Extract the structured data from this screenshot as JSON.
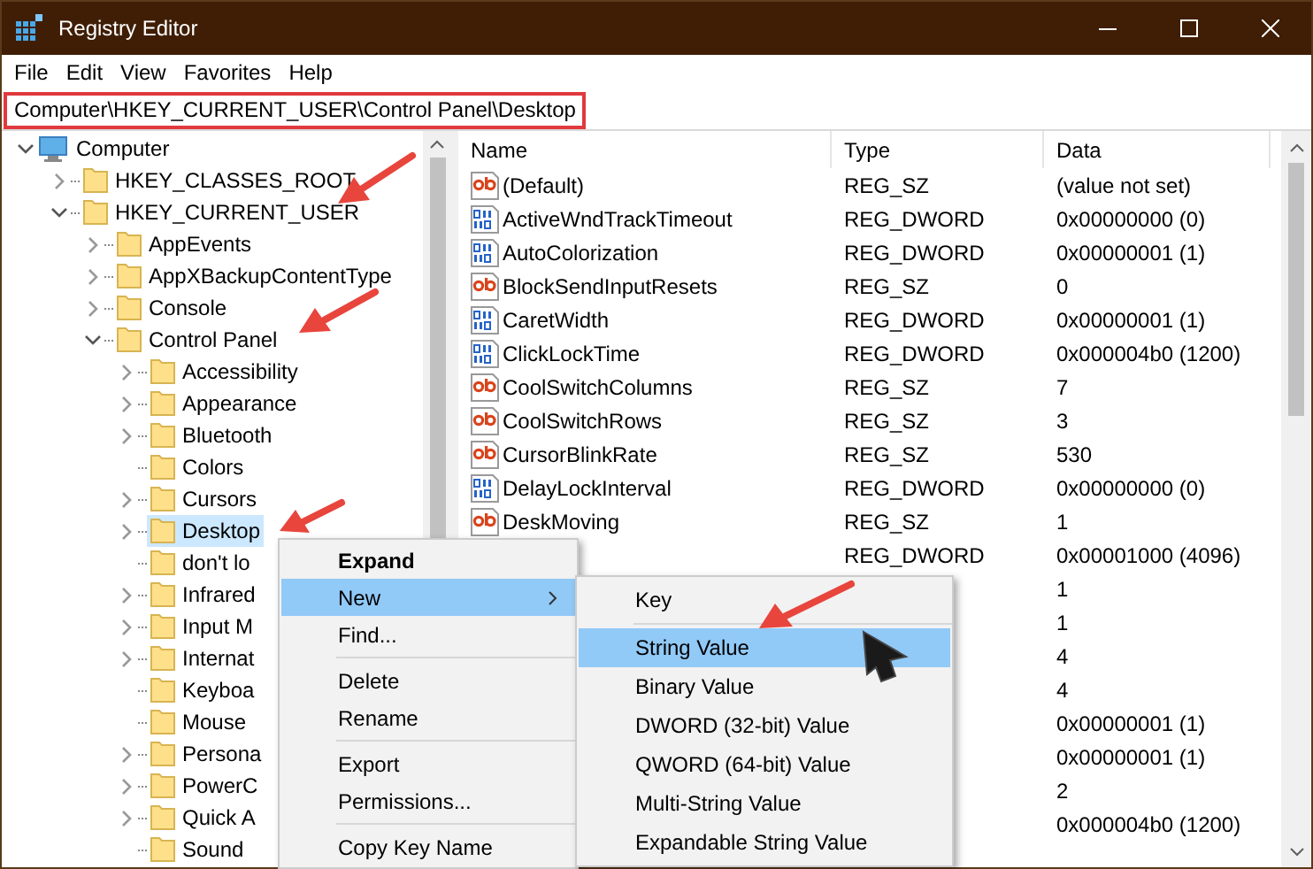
{
  "window": {
    "title": "Registry Editor"
  },
  "menu_bar": [
    "File",
    "Edit",
    "View",
    "Favorites",
    "Help"
  ],
  "address_bar": {
    "value": "Computer\\HKEY_CURRENT_USER\\Control Panel\\Desktop"
  },
  "tree": [
    {
      "label": "Computer",
      "kind": "computer",
      "expandable": true,
      "expanded": true,
      "selected": false,
      "children": [
        {
          "label": "HKEY_CLASSES_ROOT",
          "kind": "folder",
          "expandable": true,
          "expanded": false,
          "selected": false
        },
        {
          "label": "HKEY_CURRENT_USER",
          "kind": "folder",
          "expandable": true,
          "expanded": true,
          "selected": false,
          "children": [
            {
              "label": "AppEvents",
              "kind": "folder",
              "expandable": true,
              "expanded": false,
              "selected": false
            },
            {
              "label": "AppXBackupContentType",
              "kind": "folder",
              "expandable": true,
              "expanded": false,
              "selected": false
            },
            {
              "label": "Console",
              "kind": "folder",
              "expandable": true,
              "expanded": false,
              "selected": false
            },
            {
              "label": "Control Panel",
              "kind": "folder",
              "expandable": true,
              "expanded": true,
              "selected": false,
              "children": [
                {
                  "label": "Accessibility",
                  "kind": "folder",
                  "expandable": true,
                  "expanded": false,
                  "selected": false
                },
                {
                  "label": "Appearance",
                  "kind": "folder",
                  "expandable": true,
                  "expanded": false,
                  "selected": false
                },
                {
                  "label": "Bluetooth",
                  "kind": "folder",
                  "expandable": true,
                  "expanded": false,
                  "selected": false
                },
                {
                  "label": "Colors",
                  "kind": "folder",
                  "expandable": false,
                  "selected": false
                },
                {
                  "label": "Cursors",
                  "kind": "folder",
                  "expandable": true,
                  "expanded": false,
                  "selected": false
                },
                {
                  "label": "Desktop",
                  "kind": "folder",
                  "expandable": true,
                  "expanded": false,
                  "selected": true
                },
                {
                  "label": "don't lo",
                  "kind": "folder",
                  "expandable": false,
                  "selected": false
                },
                {
                  "label": "Infrared",
                  "kind": "folder",
                  "expandable": true,
                  "expanded": false,
                  "selected": false
                },
                {
                  "label": "Input M",
                  "kind": "folder",
                  "expandable": true,
                  "expanded": false,
                  "selected": false
                },
                {
                  "label": "Internat",
                  "kind": "folder",
                  "expandable": true,
                  "expanded": false,
                  "selected": false
                },
                {
                  "label": "Keyboa",
                  "kind": "folder",
                  "expandable": false,
                  "selected": false
                },
                {
                  "label": "Mouse",
                  "kind": "folder",
                  "expandable": false,
                  "selected": false
                },
                {
                  "label": "Persona",
                  "kind": "folder",
                  "expandable": true,
                  "expanded": false,
                  "selected": false
                },
                {
                  "label": "PowerC",
                  "kind": "folder",
                  "expandable": true,
                  "expanded": false,
                  "selected": false
                },
                {
                  "label": "Quick A",
                  "kind": "folder",
                  "expandable": true,
                  "expanded": false,
                  "selected": false
                },
                {
                  "label": "Sound",
                  "kind": "folder",
                  "expandable": false,
                  "selected": false
                }
              ]
            }
          ]
        }
      ]
    }
  ],
  "values": {
    "columns": [
      "Name",
      "Type",
      "Data"
    ],
    "rows": [
      {
        "kind": "string",
        "name": "(Default)",
        "type": "REG_SZ",
        "data": "(value not set)"
      },
      {
        "kind": "dword",
        "name": "ActiveWndTrackTimeout",
        "type": "REG_DWORD",
        "data": "0x00000000 (0)"
      },
      {
        "kind": "dword",
        "name": "AutoColorization",
        "type": "REG_DWORD",
        "data": "0x00000001 (1)"
      },
      {
        "kind": "string",
        "name": "BlockSendInputResets",
        "type": "REG_SZ",
        "data": "0"
      },
      {
        "kind": "dword",
        "name": "CaretWidth",
        "type": "REG_DWORD",
        "data": "0x00000001 (1)"
      },
      {
        "kind": "dword",
        "name": "ClickLockTime",
        "type": "REG_DWORD",
        "data": "0x000004b0 (1200)"
      },
      {
        "kind": "string",
        "name": "CoolSwitchColumns",
        "type": "REG_SZ",
        "data": "7"
      },
      {
        "kind": "string",
        "name": "CoolSwitchRows",
        "type": "REG_SZ",
        "data": "3"
      },
      {
        "kind": "string",
        "name": "CursorBlinkRate",
        "type": "REG_SZ",
        "data": "530"
      },
      {
        "kind": "dword",
        "name": "DelayLockInterval",
        "type": "REG_DWORD",
        "data": "0x00000000 (0)"
      },
      {
        "kind": "string",
        "name": "DeskMoving",
        "type": "REG_SZ",
        "data": "1"
      },
      {
        "type": "REG_DWORD",
        "data": "0x00001000 (4096)"
      },
      {
        "data": "1"
      },
      {
        "data": "1"
      },
      {
        "data": "4"
      },
      {
        "data": "4"
      },
      {
        "data": "0x00000001 (1)"
      },
      {
        "data": "0x00000001 (1)"
      },
      {
        "data": "2"
      },
      {
        "data": "0x000004b0 (1200)"
      }
    ]
  },
  "context_menu": [
    {
      "kind": "item",
      "label": "Expand",
      "bold": true,
      "selected": false,
      "submenu": false
    },
    {
      "kind": "item",
      "label": "New",
      "bold": false,
      "selected": true,
      "submenu": true
    },
    {
      "kind": "item",
      "label": "Find...",
      "bold": false,
      "selected": false,
      "submenu": false
    },
    {
      "kind": "separator"
    },
    {
      "kind": "item",
      "label": "Delete",
      "bold": false,
      "selected": false,
      "submenu": false
    },
    {
      "kind": "item",
      "label": "Rename",
      "bold": false,
      "selected": false,
      "submenu": false
    },
    {
      "kind": "separator"
    },
    {
      "kind": "item",
      "label": "Export",
      "bold": false,
      "selected": false,
      "submenu": false
    },
    {
      "kind": "item",
      "label": "Permissions...",
      "bold": false,
      "selected": false,
      "submenu": false
    },
    {
      "kind": "separator"
    },
    {
      "kind": "item",
      "label": "Copy Key Name",
      "bold": false,
      "selected": false,
      "submenu": false
    }
  ],
  "submenu": [
    {
      "kind": "item",
      "label": "Key",
      "selected": false
    },
    {
      "kind": "separator"
    },
    {
      "kind": "item",
      "label": "String Value",
      "selected": true
    },
    {
      "kind": "item",
      "label": "Binary Value",
      "selected": false
    },
    {
      "kind": "item",
      "label": "DWORD (32-bit) Value",
      "selected": false
    },
    {
      "kind": "item",
      "label": "QWORD (64-bit) Value",
      "selected": false
    },
    {
      "kind": "item",
      "label": "Multi-String Value",
      "selected": false
    },
    {
      "kind": "item",
      "label": "Expandable String Value",
      "selected": false
    }
  ]
}
